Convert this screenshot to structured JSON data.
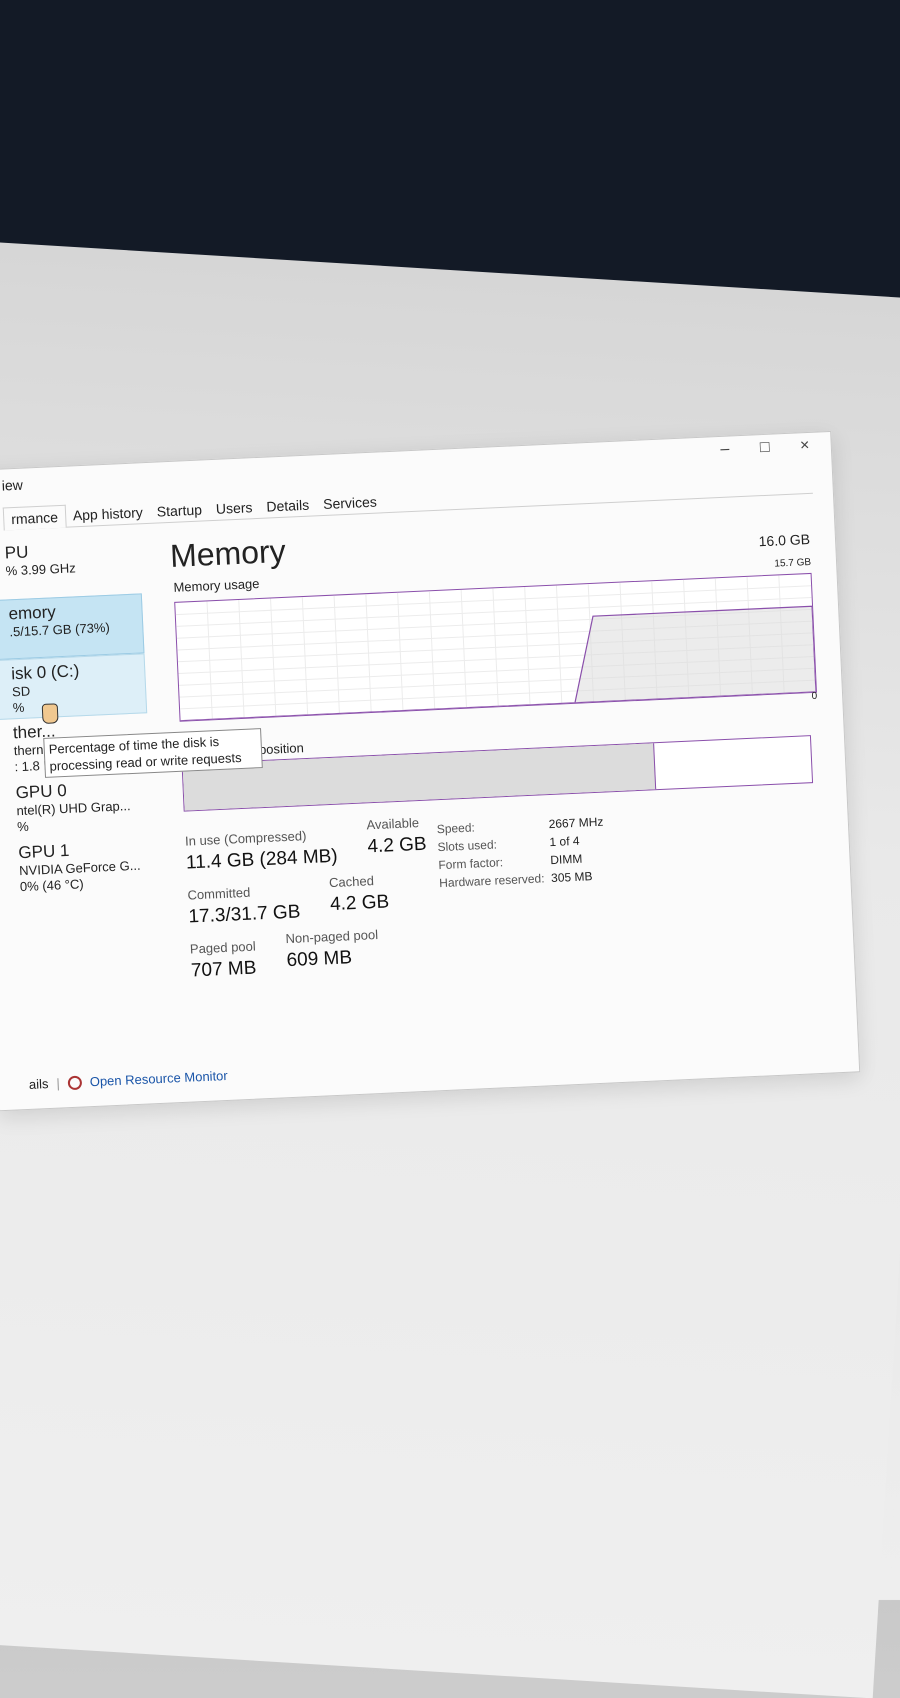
{
  "menu": {
    "view_label": "iew"
  },
  "window_controls": {
    "minimize": "–",
    "maximize": "□",
    "close": "×"
  },
  "tabs": [
    "rmance",
    "App history",
    "Startup",
    "Users",
    "Details",
    "Services"
  ],
  "sidebar": {
    "items": [
      {
        "name": "PU",
        "lines": [
          "% 3.99 GHz"
        ]
      },
      {
        "name": "emory",
        "lines": [
          ".5/15.7 GB (73%)"
        ]
      },
      {
        "name": "isk 0 (C:)",
        "lines": [
          "SD",
          "%"
        ]
      },
      {
        "name": "ther...",
        "lines": [
          "thernet 2",
          ": 1.8 R: 88.2 Mbps"
        ]
      },
      {
        "name": "GPU 0",
        "lines": [
          "ntel(R) UHD Grap...",
          "%"
        ]
      },
      {
        "name": "GPU 1",
        "lines": [
          "NVIDIA GeForce G...",
          "0% (46 °C)"
        ]
      }
    ]
  },
  "tooltip": {
    "text": "Percentage of time the disk is processing read or write requests"
  },
  "main": {
    "title": "Memory",
    "total": "16.0 GB",
    "usage_label": "Memory usage",
    "usage_max": "15.7 GB",
    "usage_min": "0",
    "composition_label": "position",
    "composition_in_use_fraction": 0.75
  },
  "chart_data": {
    "type": "area",
    "series": [
      {
        "values": [
          0,
          0,
          0,
          0,
          0,
          0,
          0,
          0,
          0,
          0,
          0,
          0,
          0,
          0,
          0,
          0,
          0,
          0,
          0,
          11.4,
          11.4,
          11.4,
          11.4,
          11.4,
          11.4,
          11.4,
          11.4,
          11.4,
          11.4,
          11.4
        ]
      }
    ],
    "ylim": [
      0,
      15.7
    ],
    "grid": true
  },
  "stats": {
    "in_use": {
      "label": "In use (Compressed)",
      "value": "11.4 GB (284 MB)"
    },
    "available": {
      "label": "Available",
      "value": "4.2 GB"
    },
    "committed": {
      "label": "Committed",
      "value": "17.3/31.7 GB"
    },
    "cached": {
      "label": "Cached",
      "value": "4.2 GB"
    },
    "paged_pool": {
      "label": "Paged pool",
      "value": "707 MB"
    },
    "non_paged_pool": {
      "label": "Non-paged pool",
      "value": "609 MB"
    }
  },
  "hardware": {
    "speed": {
      "label": "Speed:",
      "value": "2667 MHz"
    },
    "slots": {
      "label": "Slots used:",
      "value": "1 of 4"
    },
    "form_factor": {
      "label": "Form factor:",
      "value": "DIMM"
    },
    "reserved": {
      "label": "Hardware reserved:",
      "value": "305 MB"
    }
  },
  "footer": {
    "details_label": "ails",
    "resource_monitor_label": "Open Resource Monitor"
  },
  "colors": {
    "accent": "#8a4fab",
    "selected_bg": "#c5e4f3",
    "link": "#1a55a8"
  }
}
